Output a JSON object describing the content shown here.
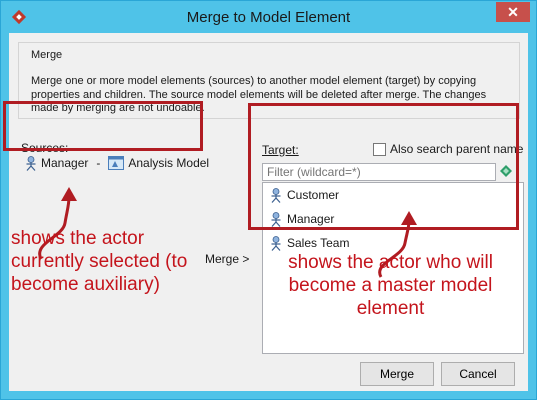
{
  "window": {
    "title": "Merge to Model Element",
    "close_glyph": "✕"
  },
  "merge_group": {
    "title": "Merge",
    "description": "Merge one or more model elements (sources) to another model element (target) by copying properties and children. The source model elements will be deleted after merge. The changes made by merging are not undoable."
  },
  "sources": {
    "label": "Sources:",
    "item": {
      "name": "Manager",
      "separator": "-",
      "model": "Analysis Model",
      "icon": "actor-icon",
      "model_icon": "model-icon"
    }
  },
  "target": {
    "label": "Target:",
    "also_search_label": "Also search parent name",
    "also_search_checked": false,
    "filter_placeholder": "Filter (wildcard=*)",
    "items": [
      {
        "label": "Customer",
        "icon": "actor-icon"
      },
      {
        "label": "Manager",
        "icon": "actor-icon"
      },
      {
        "label": "Sales Team",
        "icon": "actor-icon"
      }
    ]
  },
  "merge_arrow_label": "Merge >",
  "buttons": {
    "merge": "Merge",
    "cancel": "Cancel"
  },
  "annotations": {
    "left": "shows the actor currently selected (to become auxiliary)",
    "right": "shows the actor who will become a master model element",
    "color": "#c4141c"
  }
}
